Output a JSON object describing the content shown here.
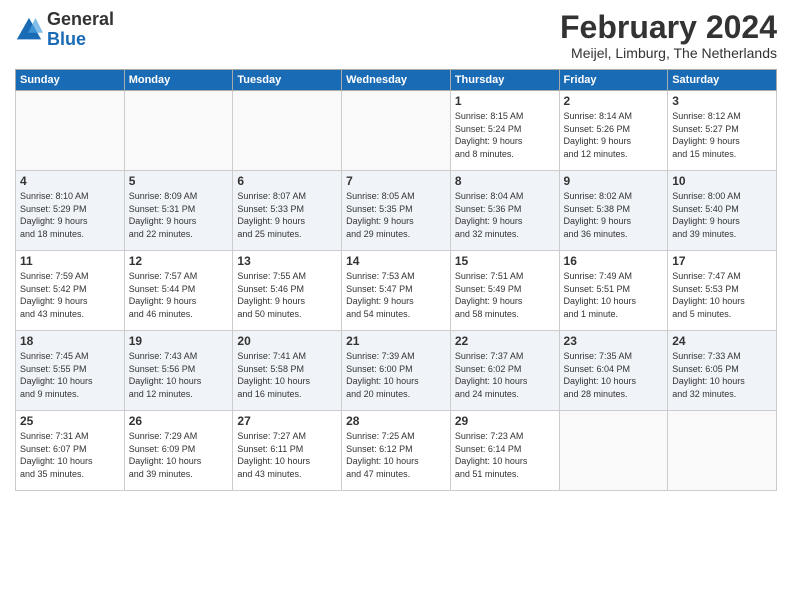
{
  "header": {
    "logo_line1": "General",
    "logo_line2": "Blue",
    "month": "February 2024",
    "location": "Meijel, Limburg, The Netherlands"
  },
  "days_of_week": [
    "Sunday",
    "Monday",
    "Tuesday",
    "Wednesday",
    "Thursday",
    "Friday",
    "Saturday"
  ],
  "weeks": [
    [
      {
        "day": "",
        "info": ""
      },
      {
        "day": "",
        "info": ""
      },
      {
        "day": "",
        "info": ""
      },
      {
        "day": "",
        "info": ""
      },
      {
        "day": "1",
        "info": "Sunrise: 8:15 AM\nSunset: 5:24 PM\nDaylight: 9 hours\nand 8 minutes."
      },
      {
        "day": "2",
        "info": "Sunrise: 8:14 AM\nSunset: 5:26 PM\nDaylight: 9 hours\nand 12 minutes."
      },
      {
        "day": "3",
        "info": "Sunrise: 8:12 AM\nSunset: 5:27 PM\nDaylight: 9 hours\nand 15 minutes."
      }
    ],
    [
      {
        "day": "4",
        "info": "Sunrise: 8:10 AM\nSunset: 5:29 PM\nDaylight: 9 hours\nand 18 minutes."
      },
      {
        "day": "5",
        "info": "Sunrise: 8:09 AM\nSunset: 5:31 PM\nDaylight: 9 hours\nand 22 minutes."
      },
      {
        "day": "6",
        "info": "Sunrise: 8:07 AM\nSunset: 5:33 PM\nDaylight: 9 hours\nand 25 minutes."
      },
      {
        "day": "7",
        "info": "Sunrise: 8:05 AM\nSunset: 5:35 PM\nDaylight: 9 hours\nand 29 minutes."
      },
      {
        "day": "8",
        "info": "Sunrise: 8:04 AM\nSunset: 5:36 PM\nDaylight: 9 hours\nand 32 minutes."
      },
      {
        "day": "9",
        "info": "Sunrise: 8:02 AM\nSunset: 5:38 PM\nDaylight: 9 hours\nand 36 minutes."
      },
      {
        "day": "10",
        "info": "Sunrise: 8:00 AM\nSunset: 5:40 PM\nDaylight: 9 hours\nand 39 minutes."
      }
    ],
    [
      {
        "day": "11",
        "info": "Sunrise: 7:59 AM\nSunset: 5:42 PM\nDaylight: 9 hours\nand 43 minutes."
      },
      {
        "day": "12",
        "info": "Sunrise: 7:57 AM\nSunset: 5:44 PM\nDaylight: 9 hours\nand 46 minutes."
      },
      {
        "day": "13",
        "info": "Sunrise: 7:55 AM\nSunset: 5:46 PM\nDaylight: 9 hours\nand 50 minutes."
      },
      {
        "day": "14",
        "info": "Sunrise: 7:53 AM\nSunset: 5:47 PM\nDaylight: 9 hours\nand 54 minutes."
      },
      {
        "day": "15",
        "info": "Sunrise: 7:51 AM\nSunset: 5:49 PM\nDaylight: 9 hours\nand 58 minutes."
      },
      {
        "day": "16",
        "info": "Sunrise: 7:49 AM\nSunset: 5:51 PM\nDaylight: 10 hours\nand 1 minute."
      },
      {
        "day": "17",
        "info": "Sunrise: 7:47 AM\nSunset: 5:53 PM\nDaylight: 10 hours\nand 5 minutes."
      }
    ],
    [
      {
        "day": "18",
        "info": "Sunrise: 7:45 AM\nSunset: 5:55 PM\nDaylight: 10 hours\nand 9 minutes."
      },
      {
        "day": "19",
        "info": "Sunrise: 7:43 AM\nSunset: 5:56 PM\nDaylight: 10 hours\nand 12 minutes."
      },
      {
        "day": "20",
        "info": "Sunrise: 7:41 AM\nSunset: 5:58 PM\nDaylight: 10 hours\nand 16 minutes."
      },
      {
        "day": "21",
        "info": "Sunrise: 7:39 AM\nSunset: 6:00 PM\nDaylight: 10 hours\nand 20 minutes."
      },
      {
        "day": "22",
        "info": "Sunrise: 7:37 AM\nSunset: 6:02 PM\nDaylight: 10 hours\nand 24 minutes."
      },
      {
        "day": "23",
        "info": "Sunrise: 7:35 AM\nSunset: 6:04 PM\nDaylight: 10 hours\nand 28 minutes."
      },
      {
        "day": "24",
        "info": "Sunrise: 7:33 AM\nSunset: 6:05 PM\nDaylight: 10 hours\nand 32 minutes."
      }
    ],
    [
      {
        "day": "25",
        "info": "Sunrise: 7:31 AM\nSunset: 6:07 PM\nDaylight: 10 hours\nand 35 minutes."
      },
      {
        "day": "26",
        "info": "Sunrise: 7:29 AM\nSunset: 6:09 PM\nDaylight: 10 hours\nand 39 minutes."
      },
      {
        "day": "27",
        "info": "Sunrise: 7:27 AM\nSunset: 6:11 PM\nDaylight: 10 hours\nand 43 minutes."
      },
      {
        "day": "28",
        "info": "Sunrise: 7:25 AM\nSunset: 6:12 PM\nDaylight: 10 hours\nand 47 minutes."
      },
      {
        "day": "29",
        "info": "Sunrise: 7:23 AM\nSunset: 6:14 PM\nDaylight: 10 hours\nand 51 minutes."
      },
      {
        "day": "",
        "info": ""
      },
      {
        "day": "",
        "info": ""
      }
    ]
  ]
}
